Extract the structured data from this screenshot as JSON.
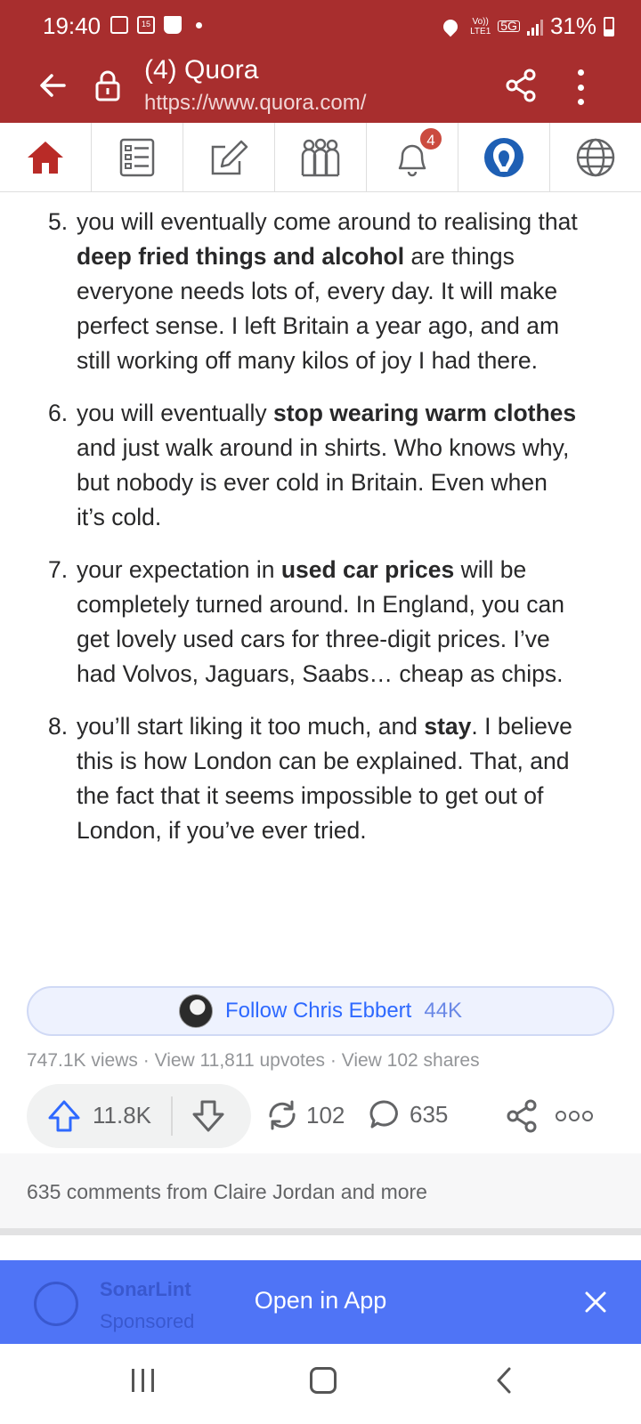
{
  "status_bar": {
    "time": "19:40",
    "calendar_day": "15",
    "network_top": "Vo))",
    "network_bottom": "LTE1",
    "network_type": "5G",
    "battery": "31%"
  },
  "browser": {
    "title": "(4) Quora",
    "url": "https://www.quora.com/"
  },
  "nav": {
    "items": [
      {
        "name": "home",
        "icon": "home-icon"
      },
      {
        "name": "following",
        "icon": "feed-list-icon"
      },
      {
        "name": "answer",
        "icon": "pen-square-icon"
      },
      {
        "name": "spaces",
        "icon": "people-group-icon"
      },
      {
        "name": "notifications",
        "icon": "bell-icon",
        "badge": "4"
      },
      {
        "name": "profile",
        "icon": "avatar-icon"
      },
      {
        "name": "language",
        "icon": "globe-icon"
      }
    ]
  },
  "answer": {
    "items": [
      {
        "number": "5.",
        "parts": [
          {
            "text": "you will eventually come around to realising that ",
            "bold": false
          },
          {
            "text": "deep fried things and alcohol",
            "bold": true
          },
          {
            "text": " are things everyone needs lots of, every day. It will make perfect sense. I left Britain a year ago, and am still working off many kilos of joy I had there.",
            "bold": false
          }
        ]
      },
      {
        "number": "6.",
        "parts": [
          {
            "text": "you will eventually ",
            "bold": false
          },
          {
            "text": "stop wearing warm clothes",
            "bold": true
          },
          {
            "text": " and just walk around in shirts. Who knows why, but nobody is ever cold in Britain. Even when it’s cold.",
            "bold": false
          }
        ]
      },
      {
        "number": "7.",
        "parts": [
          {
            "text": "your expectation in ",
            "bold": false
          },
          {
            "text": "used car prices",
            "bold": true
          },
          {
            "text": " will be completely turned around. In England, you can get lovely used cars for three-digit prices. I’ve had Volvos, Jaguars, Saabs… cheap as chips.",
            "bold": false
          }
        ]
      },
      {
        "number": "8.",
        "parts": [
          {
            "text": "you’ll start liking it too much, and ",
            "bold": false
          },
          {
            "text": "stay",
            "bold": true
          },
          {
            "text": ". I believe this is how London can be explained. That, and the fact that it seems impossible to get out of London, if you’ve ever tried.",
            "bold": false
          }
        ]
      }
    ]
  },
  "follow": {
    "label": "Follow Chris Ebbert",
    "count": "44K"
  },
  "stats": "747.1K views · View 11,811 upvotes · View 102 shares",
  "actions": {
    "upvotes": "11.8K",
    "shares": "102",
    "comments": "635"
  },
  "comments_teaser": "635 comments from Claire Jordan and more",
  "banner": {
    "ad_name": "SonarLint",
    "ad_label": "Sponsored",
    "open_app_label": "Open in App"
  },
  "colors": {
    "brand_red": "#a82e2e",
    "link_blue": "#2e69ff",
    "banner_blue": "#4f74f6"
  }
}
